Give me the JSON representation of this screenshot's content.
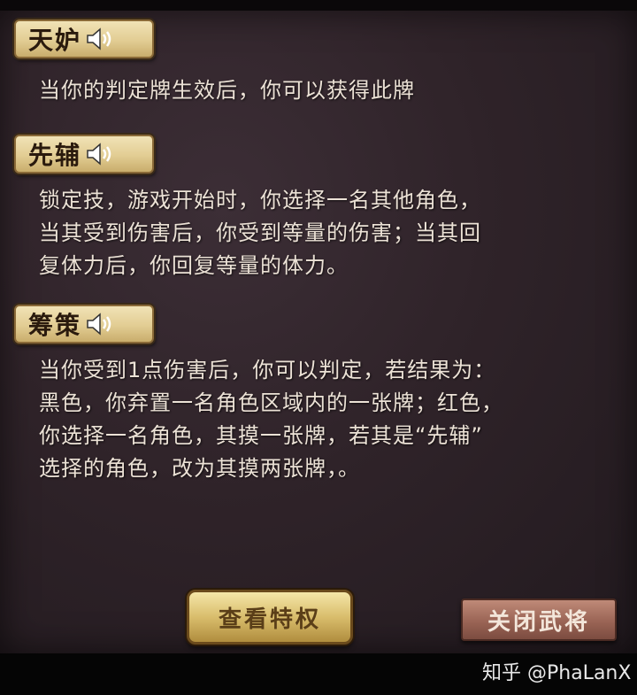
{
  "skills": [
    {
      "name": "天妒",
      "description": "当你的判定牌生效后，你可以获得此牌"
    },
    {
      "name": "先辅",
      "description": "锁定技，游戏开始时，你选择一名其他角色，\n当其受到伤害后，你受到等量的伤害；当其回\n复体力后，你回复等量的体力。"
    },
    {
      "name": "筹策",
      "description": "当你受到1点伤害后，你可以判定，若结果为：\n黑色，你弃置一名角色区域内的一张牌；红色，\n你选择一名角色，其摸一张牌，若其是“先辅”\n选择的角色，改为其摸两张牌，。"
    }
  ],
  "buttons": {
    "view_privilege": "查看特权",
    "close_general": "关闭武将"
  },
  "watermark": "知乎 @PhaLanX",
  "icons": {
    "voice": "speaker-icon"
  },
  "colors": {
    "badge_gold": "#e2cd93",
    "panel_bg": "#2f2329",
    "text": "#ece2d6",
    "close_button": "#9a6455"
  }
}
